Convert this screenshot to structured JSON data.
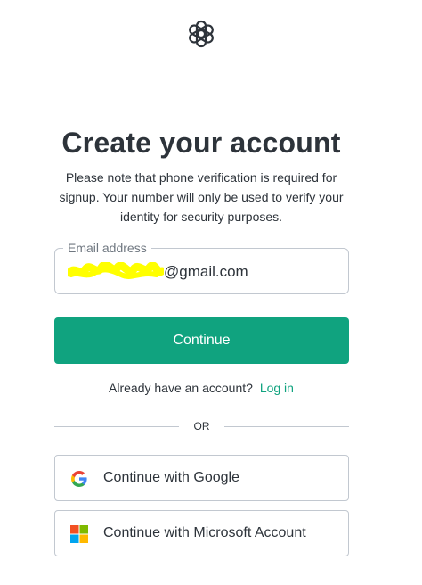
{
  "header": {
    "logo_icon": "openai-logo-icon"
  },
  "form": {
    "title": "Create your account",
    "note": "Please note that phone verification is required for signup. Your number will only be used to verify your identity for security purposes.",
    "email": {
      "label": "Email address",
      "value_suffix": "@gmail.com"
    },
    "continue_label": "Continue",
    "login_prompt": "Already have an account?",
    "login_link": "Log in",
    "divider_text": "OR"
  },
  "social": {
    "google_label": "Continue with Google",
    "microsoft_label": "Continue with Microsoft Account"
  },
  "colors": {
    "accent": "#10a37f",
    "text": "#2d333a",
    "border": "#c2c8d0",
    "redaction": "#ffff00"
  }
}
